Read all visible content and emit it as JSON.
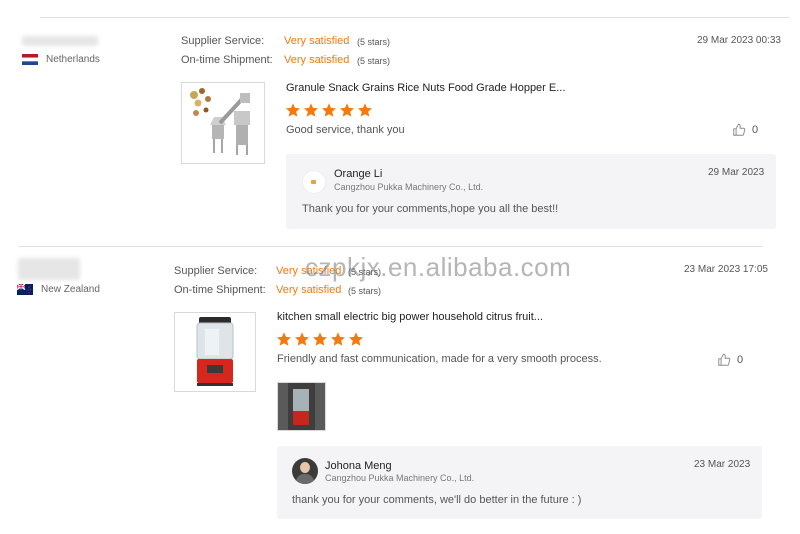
{
  "reviews": [
    {
      "country": "Netherlands",
      "supplier_service_label": "Supplier Service:",
      "supplier_service_value": "Very satisfied",
      "supplier_service_stars": "(5 stars)",
      "shipment_label": "On-time Shipment:",
      "shipment_value": "Very satisfied",
      "shipment_stars": "(5 stars)",
      "date": "29 Mar 2023 00:33",
      "product_title": "Granule Snack Grains Rice Nuts Food Grade Hopper E...",
      "rating": 5,
      "comment": "Good service, thank you",
      "likes": "0",
      "reply": {
        "name": "Orange Li",
        "company": "Cangzhou Pukka Machinery Co., Ltd.",
        "date": "29 Mar 2023",
        "text": "Thank you for your comments,hope you all the best!!"
      }
    },
    {
      "country": "New Zealand",
      "supplier_service_label": "Supplier Service:",
      "supplier_service_value": "Very satisfied",
      "supplier_service_stars": "(5 stars)",
      "shipment_label": "On-time Shipment:",
      "shipment_value": "Very satisfied",
      "shipment_stars": "(5 stars)",
      "date": "23 Mar 2023 17:05",
      "product_title": "kitchen small electric big power household citrus fruit...",
      "rating": 5,
      "comment": "Friendly and fast communication, made for a very smooth process.",
      "likes": "0",
      "reply": {
        "name": "Johona Meng",
        "company": "Cangzhou Pukka Machinery Co., Ltd.",
        "date": "23 Mar 2023",
        "text": "thank you for your comments, we'll do better in the future : )"
      }
    }
  ],
  "watermark": "czpkjx.en.alibaba.com",
  "colors": {
    "accent": "#f27a0f",
    "star": "#f27a0f",
    "reply_bg": "#f4f4f6"
  },
  "icons": {
    "like": "thumbs-up-icon",
    "star": "star-icon"
  }
}
